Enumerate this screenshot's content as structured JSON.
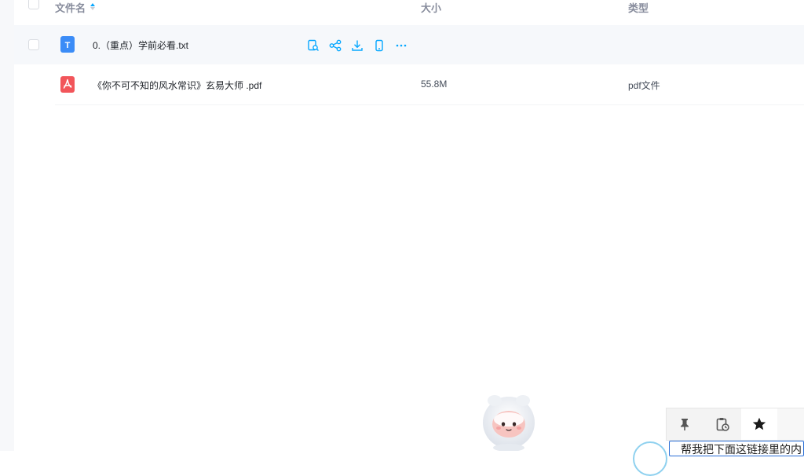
{
  "header": {
    "col_name": "文件名",
    "col_size": "大小",
    "col_type": "类型",
    "sort_icon": "sort-asc-icon"
  },
  "rows": [
    {
      "name": "0.（重点）学前必看.txt",
      "size": "",
      "type": "",
      "icon": "txt-file-icon",
      "icon_color": "#3b8cf7",
      "icon_letter": "T",
      "hovered": true
    },
    {
      "name": "《你不可不知的风水常识》玄易大师 .pdf",
      "size": "55.8M",
      "type": "pdf文件",
      "icon": "pdf-file-icon",
      "icon_color": "#f2555a",
      "hovered": false
    }
  ],
  "row_actions": [
    "preview-icon",
    "share-icon",
    "download-icon",
    "send-to-phone-icon",
    "more-icon"
  ],
  "accent_color": "#06a7ff",
  "floating_toolbar": {
    "buttons": [
      "pin-icon",
      "clipboard-history-icon",
      "star-icon"
    ],
    "input_text": "帮我把下面这链接里的内"
  }
}
